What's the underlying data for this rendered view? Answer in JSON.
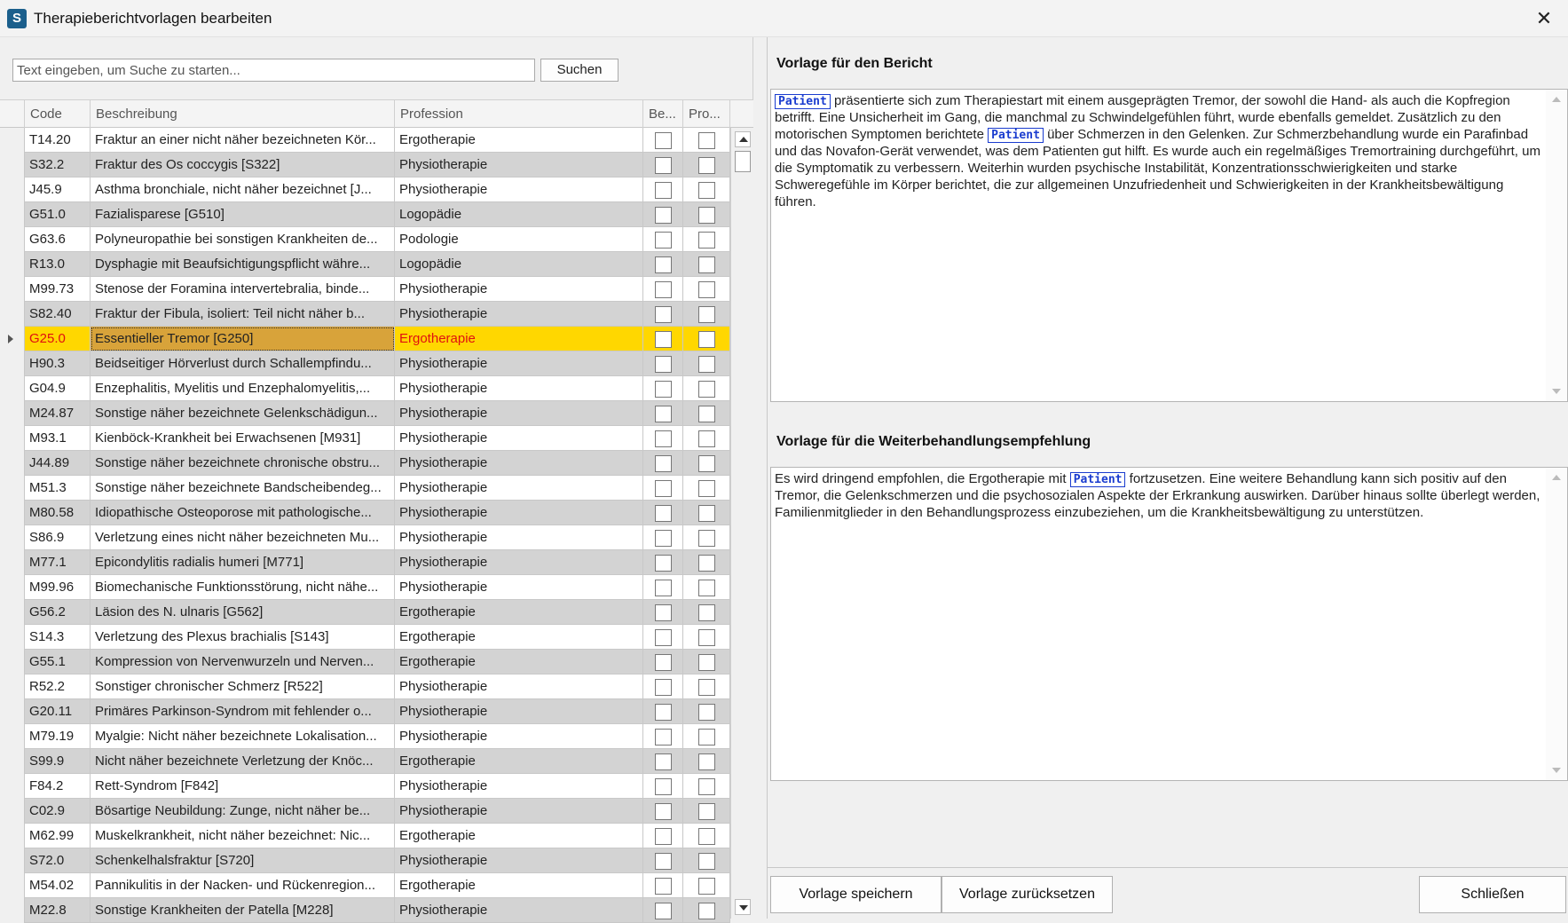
{
  "window": {
    "app_icon_letter": "S",
    "title": "Therapieberichtvorlagen bearbeiten",
    "close_glyph": "✕"
  },
  "search": {
    "placeholder": "Text eingeben, um Suche zu starten...",
    "value": "",
    "button_label": "Suchen"
  },
  "grid": {
    "columns": [
      "Code",
      "Beschreibung",
      "Profession",
      "Be...",
      "Pro..."
    ],
    "selected_index": 8,
    "rows": [
      {
        "code": "T14.20",
        "desc": "Fraktur an einer nicht näher bezeichneten Kör...",
        "prof": "Ergotherapie"
      },
      {
        "code": "S32.2",
        "desc": "Fraktur des Os coccygis [S322]",
        "prof": "Physiotherapie"
      },
      {
        "code": "J45.9",
        "desc": "Asthma bronchiale, nicht näher bezeichnet [J...",
        "prof": "Physiotherapie"
      },
      {
        "code": "G51.0",
        "desc": "Fazialisparese [G510]",
        "prof": "Logopädie"
      },
      {
        "code": "G63.6",
        "desc": "Polyneuropathie bei sonstigen Krankheiten de...",
        "prof": "Podologie"
      },
      {
        "code": "R13.0",
        "desc": "Dysphagie mit Beaufsichtigungspflicht währe...",
        "prof": "Logopädie"
      },
      {
        "code": "M99.73",
        "desc": "Stenose der Foramina intervertebralia, binde...",
        "prof": "Physiotherapie"
      },
      {
        "code": "S82.40",
        "desc": "Fraktur der Fibula, isoliert: Teil nicht näher b...",
        "prof": "Physiotherapie"
      },
      {
        "code": "G25.0",
        "desc": "Essentieller Tremor [G250]",
        "prof": "Ergotherapie"
      },
      {
        "code": "H90.3",
        "desc": "Beidseitiger Hörverlust durch Schallempfindu...",
        "prof": "Physiotherapie"
      },
      {
        "code": "G04.9",
        "desc": "Enzephalitis, Myelitis und Enzephalomyelitis,...",
        "prof": "Physiotherapie"
      },
      {
        "code": "M24.87",
        "desc": "Sonstige näher bezeichnete Gelenkschädigun...",
        "prof": "Physiotherapie"
      },
      {
        "code": "M93.1",
        "desc": "Kienböck-Krankheit bei Erwachsenen [M931]",
        "prof": "Physiotherapie"
      },
      {
        "code": "J44.89",
        "desc": "Sonstige näher bezeichnete chronische obstru...",
        "prof": "Physiotherapie"
      },
      {
        "code": "M51.3",
        "desc": "Sonstige näher bezeichnete Bandscheibendeg...",
        "prof": "Physiotherapie"
      },
      {
        "code": "M80.58",
        "desc": "Idiopathische Osteoporose mit pathologische...",
        "prof": "Physiotherapie"
      },
      {
        "code": "S86.9",
        "desc": "Verletzung eines nicht näher bezeichneten Mu...",
        "prof": "Physiotherapie"
      },
      {
        "code": "M77.1",
        "desc": "Epicondylitis radialis humeri [M771]",
        "prof": "Physiotherapie"
      },
      {
        "code": "M99.96",
        "desc": "Biomechanische Funktionsstörung, nicht nähe...",
        "prof": "Physiotherapie"
      },
      {
        "code": "G56.2",
        "desc": "Läsion des N. ulnaris [G562]",
        "prof": "Ergotherapie"
      },
      {
        "code": "S14.3",
        "desc": "Verletzung des Plexus brachialis [S143]",
        "prof": "Ergotherapie"
      },
      {
        "code": "G55.1",
        "desc": "Kompression von Nervenwurzeln und Nerven...",
        "prof": "Ergotherapie"
      },
      {
        "code": "R52.2",
        "desc": "Sonstiger chronischer Schmerz [R522]",
        "prof": "Physiotherapie"
      },
      {
        "code": "G20.11",
        "desc": "Primäres Parkinson-Syndrom mit fehlender o...",
        "prof": "Physiotherapie"
      },
      {
        "code": "M79.19",
        "desc": "Myalgie: Nicht näher bezeichnete Lokalisation...",
        "prof": "Physiotherapie"
      },
      {
        "code": "S99.9",
        "desc": "Nicht näher bezeichnete Verletzung der Knöc...",
        "prof": "Ergotherapie"
      },
      {
        "code": "F84.2",
        "desc": "Rett-Syndrom [F842]",
        "prof": "Physiotherapie"
      },
      {
        "code": "C02.9",
        "desc": "Bösartige Neubildung: Zunge, nicht näher be...",
        "prof": "Physiotherapie"
      },
      {
        "code": "M62.99",
        "desc": "Muskelkrankheit, nicht näher bezeichnet: Nic...",
        "prof": "Ergotherapie"
      },
      {
        "code": "S72.0",
        "desc": "Schenkelhalsfraktur [S720]",
        "prof": "Physiotherapie"
      },
      {
        "code": "M54.02",
        "desc": "Pannikulitis in der Nacken- und Rückenregion...",
        "prof": "Ergotherapie"
      },
      {
        "code": "M22.8",
        "desc": "Sonstige Krankheiten der Patella [M228]",
        "prof": "Physiotherapie"
      }
    ]
  },
  "report_template": {
    "heading": "Vorlage für den Bericht",
    "token": "Patient",
    "segments": [
      {
        "type": "token",
        "text": "Patient"
      },
      {
        "type": "text",
        "text": " präsentierte sich zum Therapiestart mit einem ausgeprägten Tremor, der sowohl die Hand- als auch die Kopfregion betrifft. Eine Unsicherheit im Gang, die manchmal zu Schwindelgefühlen führt, wurde ebenfalls gemeldet. Zusätzlich zu den motorischen Symptomen berichtete "
      },
      {
        "type": "token",
        "text": "Patient"
      },
      {
        "type": "text",
        "text": " über Schmerzen in den Gelenken. Zur Schmerzbehandlung wurde ein Parafinbad und das Novafon-Gerät verwendet, was dem Patienten gut hilft. Es wurde auch ein regelmäßiges Tremortraining durchgeführt, um die Symptomatik zu verbessern. Weiterhin wurden psychische Instabilität, Konzentrationsschwierigkeiten und starke Schweregefühle im Körper berichtet, die zur allgemeinen Unzufriedenheit und Schwierigkeiten in der Krankheitsbewältigung führen."
      }
    ]
  },
  "recommendation_template": {
    "heading": "Vorlage für die Weiterbehandlungsempfehlung",
    "segments": [
      {
        "type": "text",
        "text": "Es wird dringend empfohlen, die Ergotherapie mit "
      },
      {
        "type": "token",
        "text": "Patient"
      },
      {
        "type": "text",
        "text": " fortzusetzen. Eine weitere Behandlung kann sich positiv auf den Tremor, die Gelenkschmerzen und die psychosozialen Aspekte der Erkrankung auswirken. Darüber hinaus sollte überlegt werden, Familienmitglieder in den Behandlungsprozess einzubeziehen, um die Krankheitsbewältigung zu unterstützen."
      }
    ]
  },
  "buttons": {
    "save": "Vorlage speichern",
    "reset": "Vorlage zurücksetzen",
    "close": "Schließen"
  },
  "colors": {
    "selected_row": "#ffd700",
    "selected_cell": "#d8a33a",
    "selected_text": "#e01010",
    "token": "#1a3ccf"
  }
}
